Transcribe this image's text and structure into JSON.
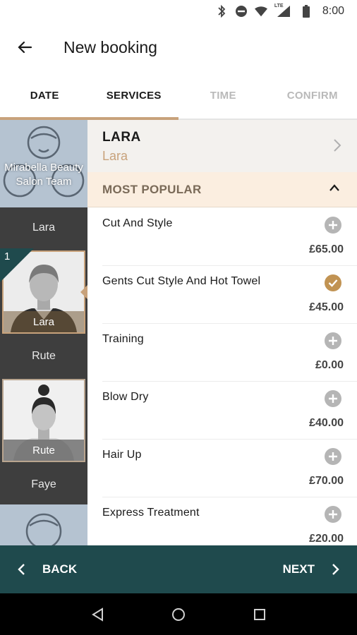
{
  "status_bar": {
    "time": "8:00",
    "network_label": "LTE"
  },
  "app_bar": {
    "title": "New booking"
  },
  "tabs": [
    {
      "label": "DATE",
      "state": "done"
    },
    {
      "label": "SERVICES",
      "state": "active"
    },
    {
      "label": "TIME",
      "state": "inactive"
    },
    {
      "label": "CONFIRM",
      "state": "inactive"
    }
  ],
  "staff": {
    "team_label": "Mirabella Beauty Salon Team",
    "items": [
      {
        "label": "Lara"
      },
      {
        "caption": "Lara",
        "badge": "1"
      },
      {
        "label": "Rute"
      },
      {
        "caption": "Rute"
      },
      {
        "label": "Faye"
      }
    ]
  },
  "stylist": {
    "name": "LARA",
    "subtitle": "Lara"
  },
  "section": {
    "label": "MOST POPULAR"
  },
  "services": [
    {
      "name": "Cut And Style",
      "price": "£65.00",
      "selected": false
    },
    {
      "name": "Gents Cut Style And Hot Towel",
      "price": "£45.00",
      "selected": true
    },
    {
      "name": "Training",
      "price": "£0.00",
      "selected": false
    },
    {
      "name": "Blow Dry",
      "price": "£40.00",
      "selected": false
    },
    {
      "name": "Hair Up",
      "price": "£70.00",
      "selected": false
    },
    {
      "name": "Express Treatment",
      "price": "£20.00",
      "selected": false
    }
  ],
  "footer": {
    "back_label": "BACK",
    "next_label": "NEXT"
  },
  "colors": {
    "accent": "#c8a27b",
    "footer_bg": "#1f4a4d",
    "selected_check": "#c19353"
  }
}
